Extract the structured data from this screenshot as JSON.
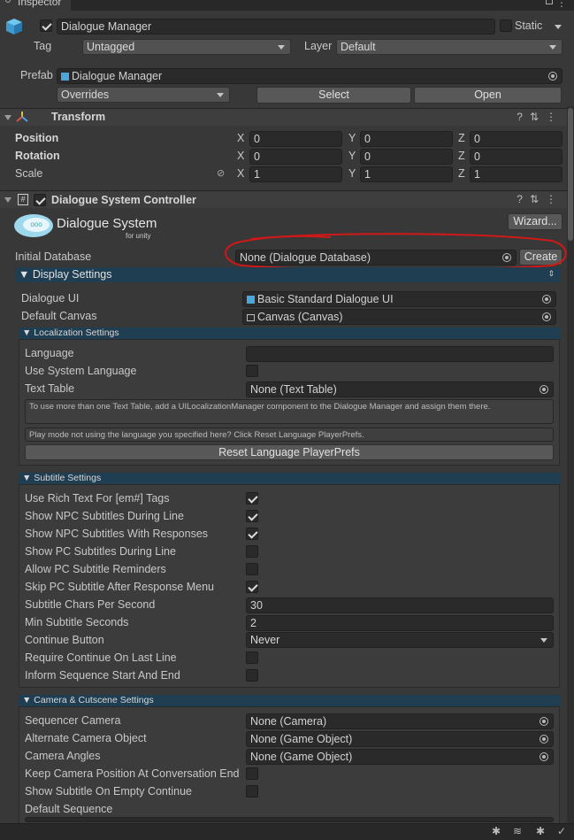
{
  "window": {
    "tab_title": "Inspector"
  },
  "gameobject": {
    "name": "Dialogue Manager",
    "static_label": "Static",
    "tag_label": "Tag",
    "tag_value": "Untagged",
    "layer_label": "Layer",
    "layer_value": "Default",
    "prefab_label": "Prefab",
    "prefab_value": "Dialogue Manager",
    "overrides_label": "Overrides",
    "select_label": "Select",
    "open_label": "Open"
  },
  "transform": {
    "title": "Transform",
    "rows": [
      {
        "label": "Position",
        "x": "0",
        "y": "0",
        "z": "0"
      },
      {
        "label": "Rotation",
        "x": "0",
        "y": "0",
        "z": "0"
      },
      {
        "label": "Scale",
        "x": "1",
        "y": "1",
        "z": "1"
      }
    ],
    "axis_x": "X",
    "axis_y": "Y",
    "axis_z": "Z"
  },
  "controller": {
    "title": "Dialogue System Controller",
    "logo_main": "Dialogue System",
    "logo_sub": "for unity",
    "logo_bubble": "ooo",
    "wizard_label": "Wizard...",
    "initial_db_label": "Initial Database",
    "initial_db_value": "None (Dialogue Database)",
    "create_label": "Create"
  },
  "display_settings": {
    "title": "▼ Display Settings",
    "dialogue_ui_label": "Dialogue UI",
    "dialogue_ui_value": "Basic Standard Dialogue UI",
    "default_canvas_label": "Default Canvas",
    "default_canvas_value": "Canvas (Canvas)"
  },
  "localization": {
    "title": "▼ Localization Settings",
    "language_label": "Language",
    "language_value": "",
    "use_system_language_label": "Use System Language",
    "text_table_label": "Text Table",
    "text_table_value": "None (Text Table)",
    "info1": "To use more than one Text Table, add a UILocalizationManager component to the Dialogue Manager and assign them there.",
    "info2": "Play mode not using the language you specified here? Click Reset Language PlayerPrefs.",
    "reset_label": "Reset Language PlayerPrefs"
  },
  "subtitle": {
    "title": "▼ Subtitle Settings",
    "rows": [
      {
        "label": "Use Rich Text For [em#] Tags",
        "checked": true
      },
      {
        "label": "Show NPC Subtitles During Line",
        "checked": true
      },
      {
        "label": "Show NPC Subtitles With Responses",
        "checked": true
      },
      {
        "label": "Show PC Subtitles During Line",
        "checked": false
      },
      {
        "label": "Allow PC Subtitle Reminders",
        "checked": false
      },
      {
        "label": "Skip PC Subtitle After Response Menu",
        "checked": true
      }
    ],
    "chars_label": "Subtitle Chars Per Second",
    "chars_value": "30",
    "min_label": "Min Subtitle Seconds",
    "min_value": "2",
    "continue_label": "Continue Button",
    "continue_value": "Never",
    "require_label": "Require Continue On Last Line",
    "inform_label": "Inform Sequence Start And End"
  },
  "camera": {
    "title": "▼ Camera & Cutscene Settings",
    "seq_cam_label": "Sequencer Camera",
    "seq_cam_value": "None (Camera)",
    "alt_cam_label": "Alternate Camera Object",
    "alt_cam_value": "None (Game Object)",
    "angles_label": "Camera Angles",
    "angles_value": "None (Game Object)",
    "keep_label": "Keep Camera Position At Conversation End",
    "empty_label": "Show Subtitle On Empty Continue",
    "default_seq_label": "Default Sequence"
  },
  "colors": {
    "highlight_ring": "#d01818",
    "section_blue": "#1f3e52"
  }
}
